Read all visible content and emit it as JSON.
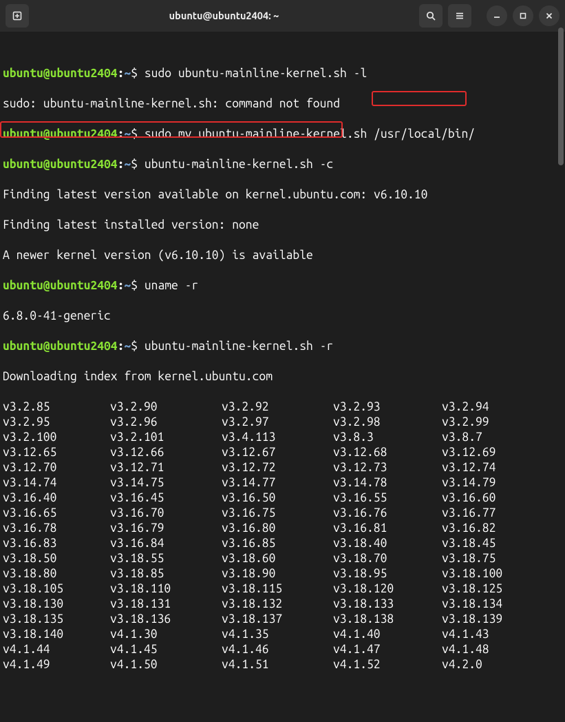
{
  "window": {
    "title": "ubuntu@ubuntu2404: ~"
  },
  "prompt": {
    "userhost": "ubuntu@ubuntu2404",
    "sep": ":",
    "path": "~",
    "dollar": "$ "
  },
  "lines": {
    "cmd1": "sudo ubuntu-mainline-kernel.sh -l",
    "out1": "sudo: ubuntu-mainline-kernel.sh: command not found",
    "cmd2": "sudo mv ubuntu-mainline-kernel.sh /usr/local/bin/",
    "cmd3": "ubuntu-mainline-kernel.sh -c",
    "out3a_pre": "Finding latest version available on kernel.ubuntu.com:",
    "out3a_hl": " v6.10.10 ",
    "out3b": "Finding latest installed version: none",
    "out3c": "A newer kernel version (v6.10.10) is available",
    "cmd4": "uname -r",
    "out4": "6.8.0-41-generic",
    "cmd5": "ubuntu-mainline-kernel.sh -r",
    "out5": "Downloading index from kernel.ubuntu.com"
  },
  "versions": [
    [
      "v3.2.85",
      "v3.2.90",
      "v3.2.92",
      "v3.2.93",
      "v3.2.94"
    ],
    [
      "v3.2.95",
      "v3.2.96",
      "v3.2.97",
      "v3.2.98",
      "v3.2.99"
    ],
    [
      "v3.2.100",
      "v3.2.101",
      "v3.4.113",
      "v3.8.3",
      "v3.8.7"
    ],
    [
      "v3.12.65",
      "v3.12.66",
      "v3.12.67",
      "v3.12.68",
      "v3.12.69"
    ],
    [
      "v3.12.70",
      "v3.12.71",
      "v3.12.72",
      "v3.12.73",
      "v3.12.74"
    ],
    [
      "v3.14.74",
      "v3.14.75",
      "v3.14.77",
      "v3.14.78",
      "v3.14.79"
    ],
    [
      "v3.16.40",
      "v3.16.45",
      "v3.16.50",
      "v3.16.55",
      "v3.16.60"
    ],
    [
      "v3.16.65",
      "v3.16.70",
      "v3.16.75",
      "v3.16.76",
      "v3.16.77"
    ],
    [
      "v3.16.78",
      "v3.16.79",
      "v3.16.80",
      "v3.16.81",
      "v3.16.82"
    ],
    [
      "v3.16.83",
      "v3.16.84",
      "v3.16.85",
      "v3.18.40",
      "v3.18.45"
    ],
    [
      "v3.18.50",
      "v3.18.55",
      "v3.18.60",
      "v3.18.70",
      "v3.18.75"
    ],
    [
      "v3.18.80",
      "v3.18.85",
      "v3.18.90",
      "v3.18.95",
      "v3.18.100"
    ],
    [
      "v3.18.105",
      "v3.18.110",
      "v3.18.115",
      "v3.18.120",
      "v3.18.125"
    ],
    [
      "v3.18.130",
      "v3.18.131",
      "v3.18.132",
      "v3.18.133",
      "v3.18.134"
    ],
    [
      "v3.18.135",
      "v3.18.136",
      "v3.18.137",
      "v3.18.138",
      "v3.18.139"
    ],
    [
      "v3.18.140",
      "v4.1.30",
      "v4.1.35",
      "v4.1.40",
      "v4.1.43"
    ],
    [
      "v4.1.44",
      "v4.1.45",
      "v4.1.46",
      "v4.1.47",
      "v4.1.48"
    ],
    [
      "v4.1.49",
      "v4.1.50",
      "v4.1.51",
      "v4.1.52",
      "v4.2.0"
    ]
  ]
}
